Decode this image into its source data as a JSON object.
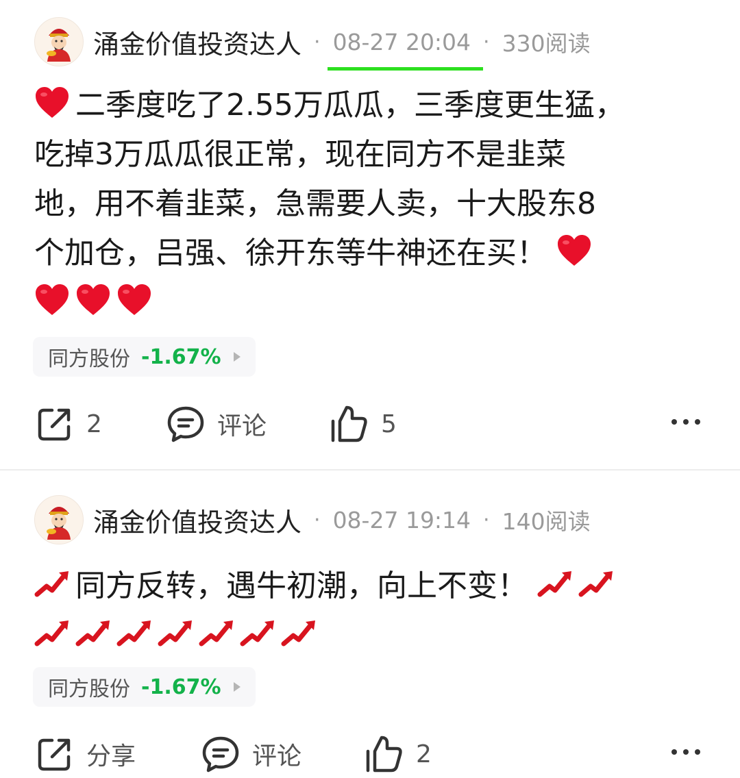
{
  "posts": [
    {
      "author": "涌金价值投资达人",
      "time": "08-27 20:04",
      "reads": "330阅读",
      "separator": "·",
      "text_lines": [
        "二季度吃了2.55万瓜瓜，三季度更生猛，",
        "吃掉3万瓜瓜很正常，现在同方不是韭菜",
        "地，用不着韭菜，急需要人卖，十大股东8",
        "个加仓，吕强、徐开东等牛神还在买！"
      ],
      "emoji": "heart",
      "stock": {
        "name": "同方股份",
        "change": "-1.67%"
      },
      "actions": {
        "share": "2",
        "comment": "评论",
        "like": "5"
      }
    },
    {
      "author": "涌金价值投资达人",
      "time": "08-27 19:14",
      "reads": "140阅读",
      "separator": "·",
      "text_lines": [
        "同方反转，遇牛初潮，向上不变！"
      ],
      "emoji": "chart-increasing",
      "stock": {
        "name": "同方股份",
        "change": "-1.67%"
      },
      "actions": {
        "share": "分享",
        "comment": "评论",
        "like": "2"
      }
    }
  ],
  "colors": {
    "highlight_underline": "#2de01f",
    "stock_down": "#13b24a",
    "heart": "#e8102a",
    "meta_gray": "#9a9a9a"
  },
  "icons": [
    "avatar-fortune-god",
    "heart-emoji",
    "chart-increasing-emoji",
    "share-icon",
    "comment-icon",
    "like-icon",
    "more-icon"
  ]
}
